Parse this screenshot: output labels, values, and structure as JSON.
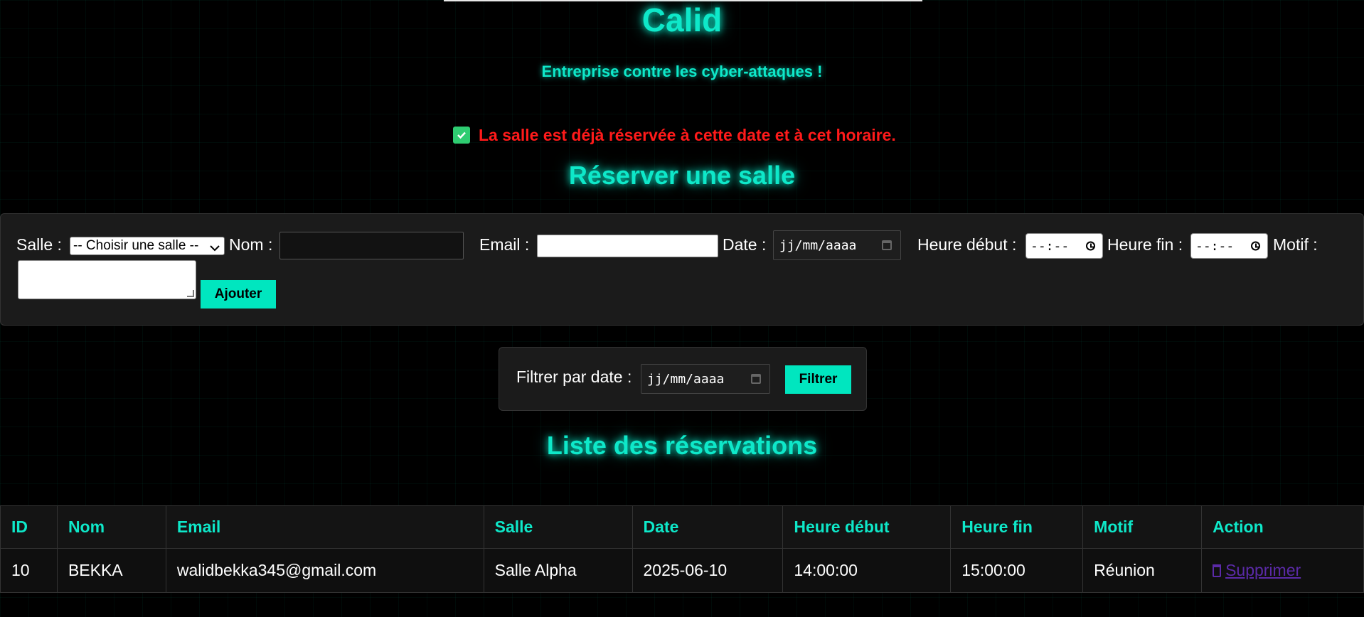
{
  "header": {
    "brand": "Calid",
    "tagline": "Entreprise contre les cyber-attaques !"
  },
  "alert": {
    "message": "La salle est déjà réservée à cette date et à cet horaire.",
    "color": "#ff1a1a"
  },
  "reserve": {
    "title": "Réserver une salle",
    "salle_label": "Salle :",
    "salle_selected": "-- Choisir une salle --",
    "nom_label": "Nom :",
    "nom_value": "",
    "email_label": "Email :",
    "email_value": "",
    "date_label": "Date :",
    "date_placeholder": "jj/mm/aaaa",
    "heure_debut_label": "Heure début :",
    "heure_debut_placeholder": "--:--",
    "heure_fin_label": "Heure fin :",
    "heure_fin_placeholder": "--:--",
    "motif_label": "Motif :",
    "motif_value": "",
    "submit_label": "Ajouter"
  },
  "filter": {
    "label": "Filtrer par date :",
    "date_placeholder": "jj/mm/aaaa",
    "button_label": "Filtrer"
  },
  "list": {
    "title": "Liste des réservations",
    "columns": [
      "ID",
      "Nom",
      "Email",
      "Salle",
      "Date",
      "Heure début",
      "Heure fin",
      "Motif",
      "Action"
    ],
    "rows": [
      {
        "id": "10",
        "nom": "BEKKA",
        "email": "walidbekka345@gmail.com",
        "salle": "Salle Alpha",
        "date": "2025-06-10",
        "heure_debut": "14:00:00",
        "heure_fin": "15:00:00",
        "motif": "Réunion",
        "action": "Supprimer"
      }
    ]
  },
  "colors": {
    "accent": "#0ee8c9",
    "button": "#00e6bf",
    "alert": "#ff1a1a",
    "check": "#2ecc71",
    "link": "#5b2aa8"
  }
}
